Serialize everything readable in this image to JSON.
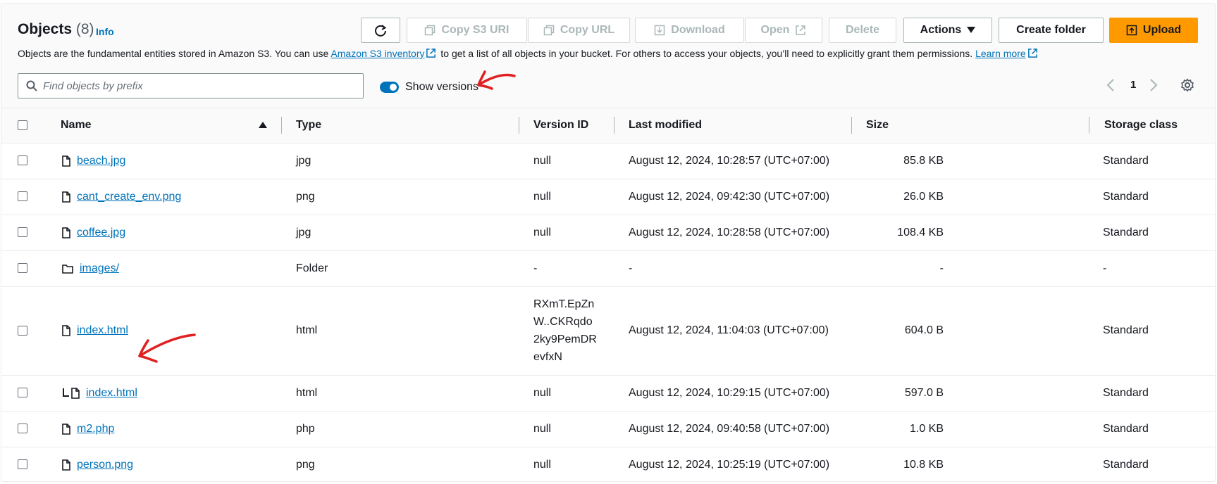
{
  "header": {
    "title": "Objects",
    "count": "(8)",
    "info": "Info",
    "description_prefix": "Objects are the fundamental entities stored in Amazon S3. You can use",
    "inventory_link": "Amazon S3 inventory",
    "description_middle": "to get a list of all objects in your bucket. For others to access your objects, you’ll need to explicitly grant them permissions.",
    "learn_more": "Learn more"
  },
  "toolbar": {
    "copy_s3_uri": "Copy S3 URI",
    "copy_url": "Copy URL",
    "download": "Download",
    "open": "Open",
    "delete": "Delete",
    "actions": "Actions",
    "create_folder": "Create folder",
    "upload": "Upload"
  },
  "filter": {
    "placeholder": "Find objects by prefix",
    "show_versions_label": "Show versions",
    "show_versions_on": true
  },
  "pagination": {
    "current_page": "1"
  },
  "table": {
    "columns": [
      "Name",
      "Type",
      "Version ID",
      "Last modified",
      "Size",
      "Storage class"
    ],
    "rows": [
      {
        "name": "beach.jpg",
        "type": "jpg",
        "version": "null",
        "modified": "August 12, 2024, 10:28:57 (UTC+07:00)",
        "size": "85.8 KB",
        "storage": "Standard",
        "icon": "file-icon"
      },
      {
        "name": "cant_create_env.png",
        "type": "png",
        "version": "null",
        "modified": "August 12, 2024, 09:42:30 (UTC+07:00)",
        "size": "26.0 KB",
        "storage": "Standard",
        "icon": "file-icon"
      },
      {
        "name": "coffee.jpg",
        "type": "jpg",
        "version": "null",
        "modified": "August 12, 2024, 10:28:58 (UTC+07:00)",
        "size": "108.4 KB",
        "storage": "Standard",
        "icon": "file-icon"
      },
      {
        "name": "images/",
        "type": "Folder",
        "version": "-",
        "modified": "-",
        "size": "-",
        "storage": "-",
        "icon": "folder-icon"
      },
      {
        "name": "index.html",
        "type": "html",
        "version": "RXmT.EpZnW..CKRqdo2ky9PemDRevfxN",
        "modified": "August 12, 2024, 11:04:03 (UTC+07:00)",
        "size": "604.0 B",
        "storage": "Standard",
        "icon": "file-icon"
      },
      {
        "name": "index.html",
        "type": "html",
        "version": "null",
        "modified": "August 12, 2024, 10:29:15 (UTC+07:00)",
        "size": "597.0 B",
        "storage": "Standard",
        "icon": "file-icon",
        "child": true
      },
      {
        "name": "m2.php",
        "type": "php",
        "version": "null",
        "modified": "August 12, 2024, 09:40:58 (UTC+07:00)",
        "size": "1.0 KB",
        "storage": "Standard",
        "icon": "file-icon"
      },
      {
        "name": "person.png",
        "type": "png",
        "version": "null",
        "modified": "August 12, 2024, 10:25:19 (UTC+07:00)",
        "size": "10.8 KB",
        "storage": "Standard",
        "icon": "file-icon"
      }
    ]
  },
  "colors": {
    "link": "#0073bb",
    "primary": "#ff9900",
    "annotation": "#e02020"
  }
}
